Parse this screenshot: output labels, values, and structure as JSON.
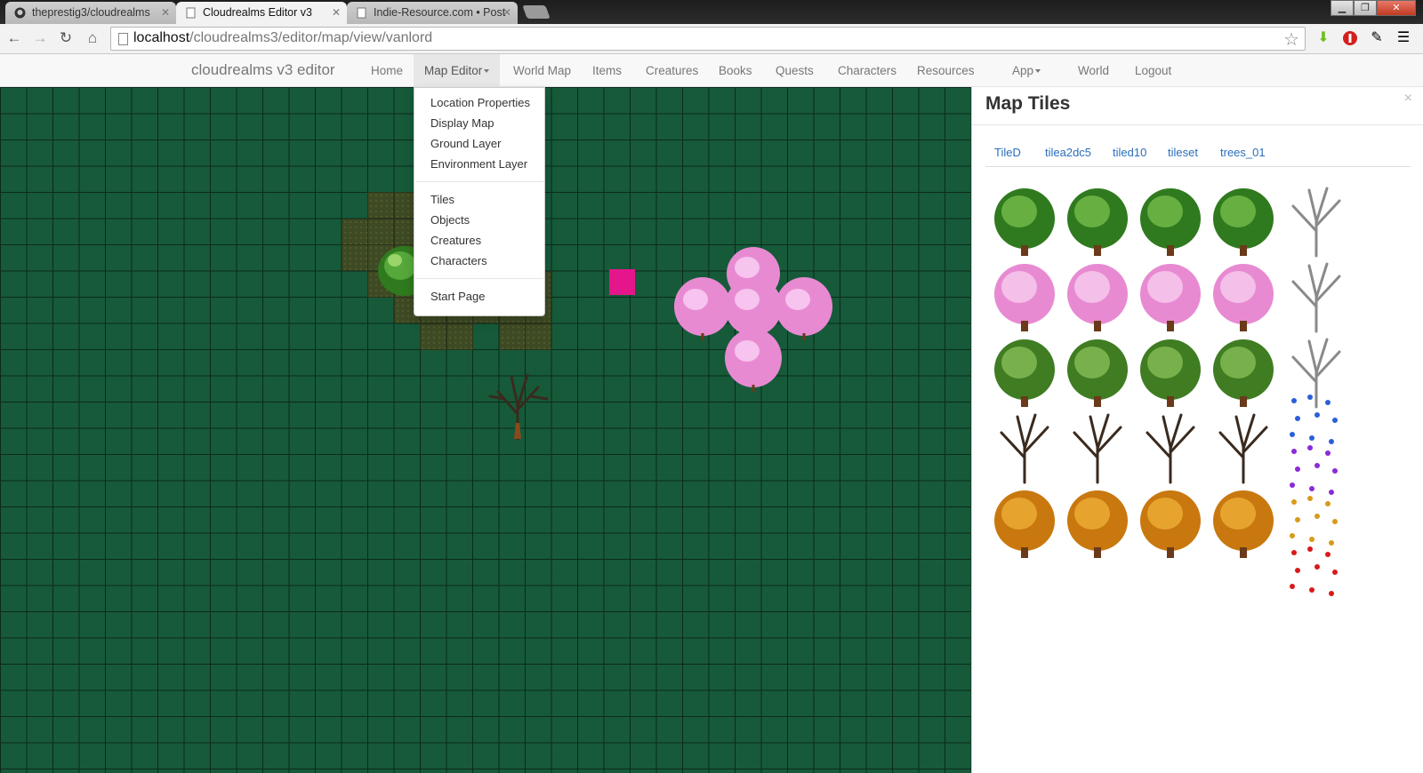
{
  "browser": {
    "tabs": [
      {
        "title": "theprestig3/cloudrealms",
        "active": false
      },
      {
        "title": "Cloudrealms Editor v3",
        "active": true
      },
      {
        "title": "Indie-Resource.com • Post",
        "active": false
      }
    ],
    "url": {
      "host": "localhost",
      "path": "/cloudrealms3/editor/map/view/vanlord"
    }
  },
  "navbar": {
    "brand": "cloudrealms v3 editor",
    "items": [
      "Home",
      "Map Editor",
      "World Map",
      "Items",
      "Creatures",
      "Books",
      "Quests",
      "Characters",
      "Resources"
    ],
    "right_items": [
      "App",
      "World",
      "Logout"
    ],
    "active_item": "Map Editor"
  },
  "dropdown": {
    "groups": [
      [
        "Location Properties",
        "Display Map",
        "Ground Layer",
        "Environment Layer"
      ],
      [
        "Tiles",
        "Objects",
        "Creatures",
        "Characters"
      ],
      [
        "Start Page"
      ]
    ]
  },
  "panel": {
    "title": "Map Tiles",
    "close_glyph": "×",
    "tilesets": [
      "TileD",
      "tilea2dc5",
      "tiled10",
      "tileset",
      "trees_01"
    ]
  },
  "colors": {
    "grass": "#165a3a",
    "selection": "#e5168c",
    "link": "#2a6ebb"
  }
}
